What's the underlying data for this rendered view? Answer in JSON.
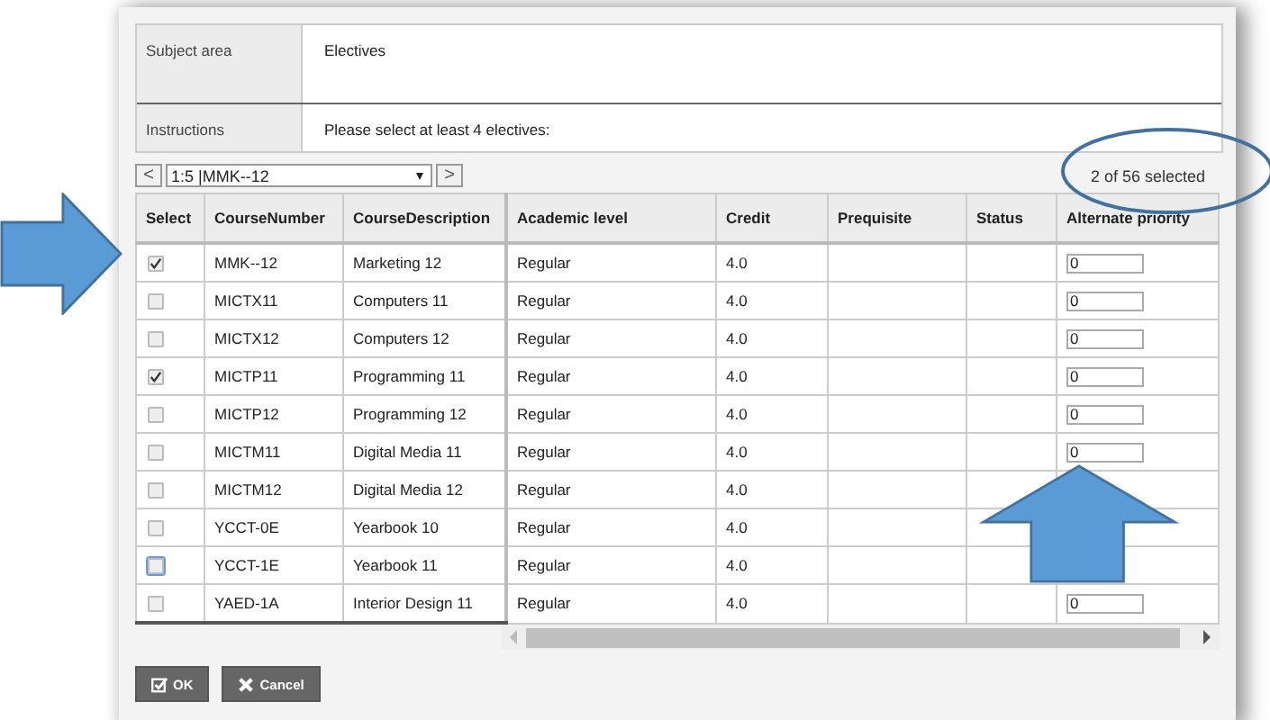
{
  "info": [
    {
      "label": "Subject area",
      "value": "Electives",
      "tall": true
    },
    {
      "label": "Instructions",
      "value": "Please select at least 4 electives:",
      "tall": false
    }
  ],
  "pager": {
    "prev": "<",
    "selector": "1:5 |MMK--12",
    "next": ">",
    "selection_count": "2 of 56 selected"
  },
  "table": {
    "columns": [
      "Select",
      "CourseNumber",
      "CourseDescription",
      "Academic level",
      "Credit",
      "Prequisite",
      "Status",
      "Alternate priority"
    ],
    "rows": [
      {
        "checked": true,
        "focused": false,
        "number": "MMK--12",
        "description": "Marketing 12",
        "level": "Regular",
        "credit": "4.0",
        "alternate_priority": "0"
      },
      {
        "checked": false,
        "focused": false,
        "number": "MICTX11",
        "description": "Computers 11",
        "level": "Regular",
        "credit": "4.0",
        "alternate_priority": "0"
      },
      {
        "checked": false,
        "focused": false,
        "number": "MICTX12",
        "description": "Computers 12",
        "level": "Regular",
        "credit": "4.0",
        "alternate_priority": "0"
      },
      {
        "checked": true,
        "focused": false,
        "number": "MICTP11",
        "description": "Programming 11",
        "level": "Regular",
        "credit": "4.0",
        "alternate_priority": "0"
      },
      {
        "checked": false,
        "focused": false,
        "number": "MICTP12",
        "description": "Programming 12",
        "level": "Regular",
        "credit": "4.0",
        "alternate_priority": "0"
      },
      {
        "checked": false,
        "focused": false,
        "number": "MICTM11",
        "description": "Digital Media 11",
        "level": "Regular",
        "credit": "4.0",
        "alternate_priority": "0"
      },
      {
        "checked": false,
        "focused": false,
        "number": "MICTM12",
        "description": "Digital Media 12",
        "level": "Regular",
        "credit": "4.0"
      },
      {
        "checked": false,
        "focused": false,
        "number": "YCCT-0E",
        "description": "Yearbook 10",
        "level": "Regular",
        "credit": "4.0"
      },
      {
        "checked": false,
        "focused": true,
        "number": "YCCT-1E",
        "description": "Yearbook 11",
        "level": "Regular",
        "credit": "4.0"
      },
      {
        "checked": false,
        "focused": false,
        "number": "YAED-1A",
        "description": "Interior Design 11",
        "level": "Regular",
        "credit": "4.0",
        "alternate_priority": "0"
      }
    ]
  },
  "buttons": [
    {
      "kind": "ok",
      "label": "OK"
    },
    {
      "kind": "cancel",
      "label": "Cancel"
    }
  ]
}
